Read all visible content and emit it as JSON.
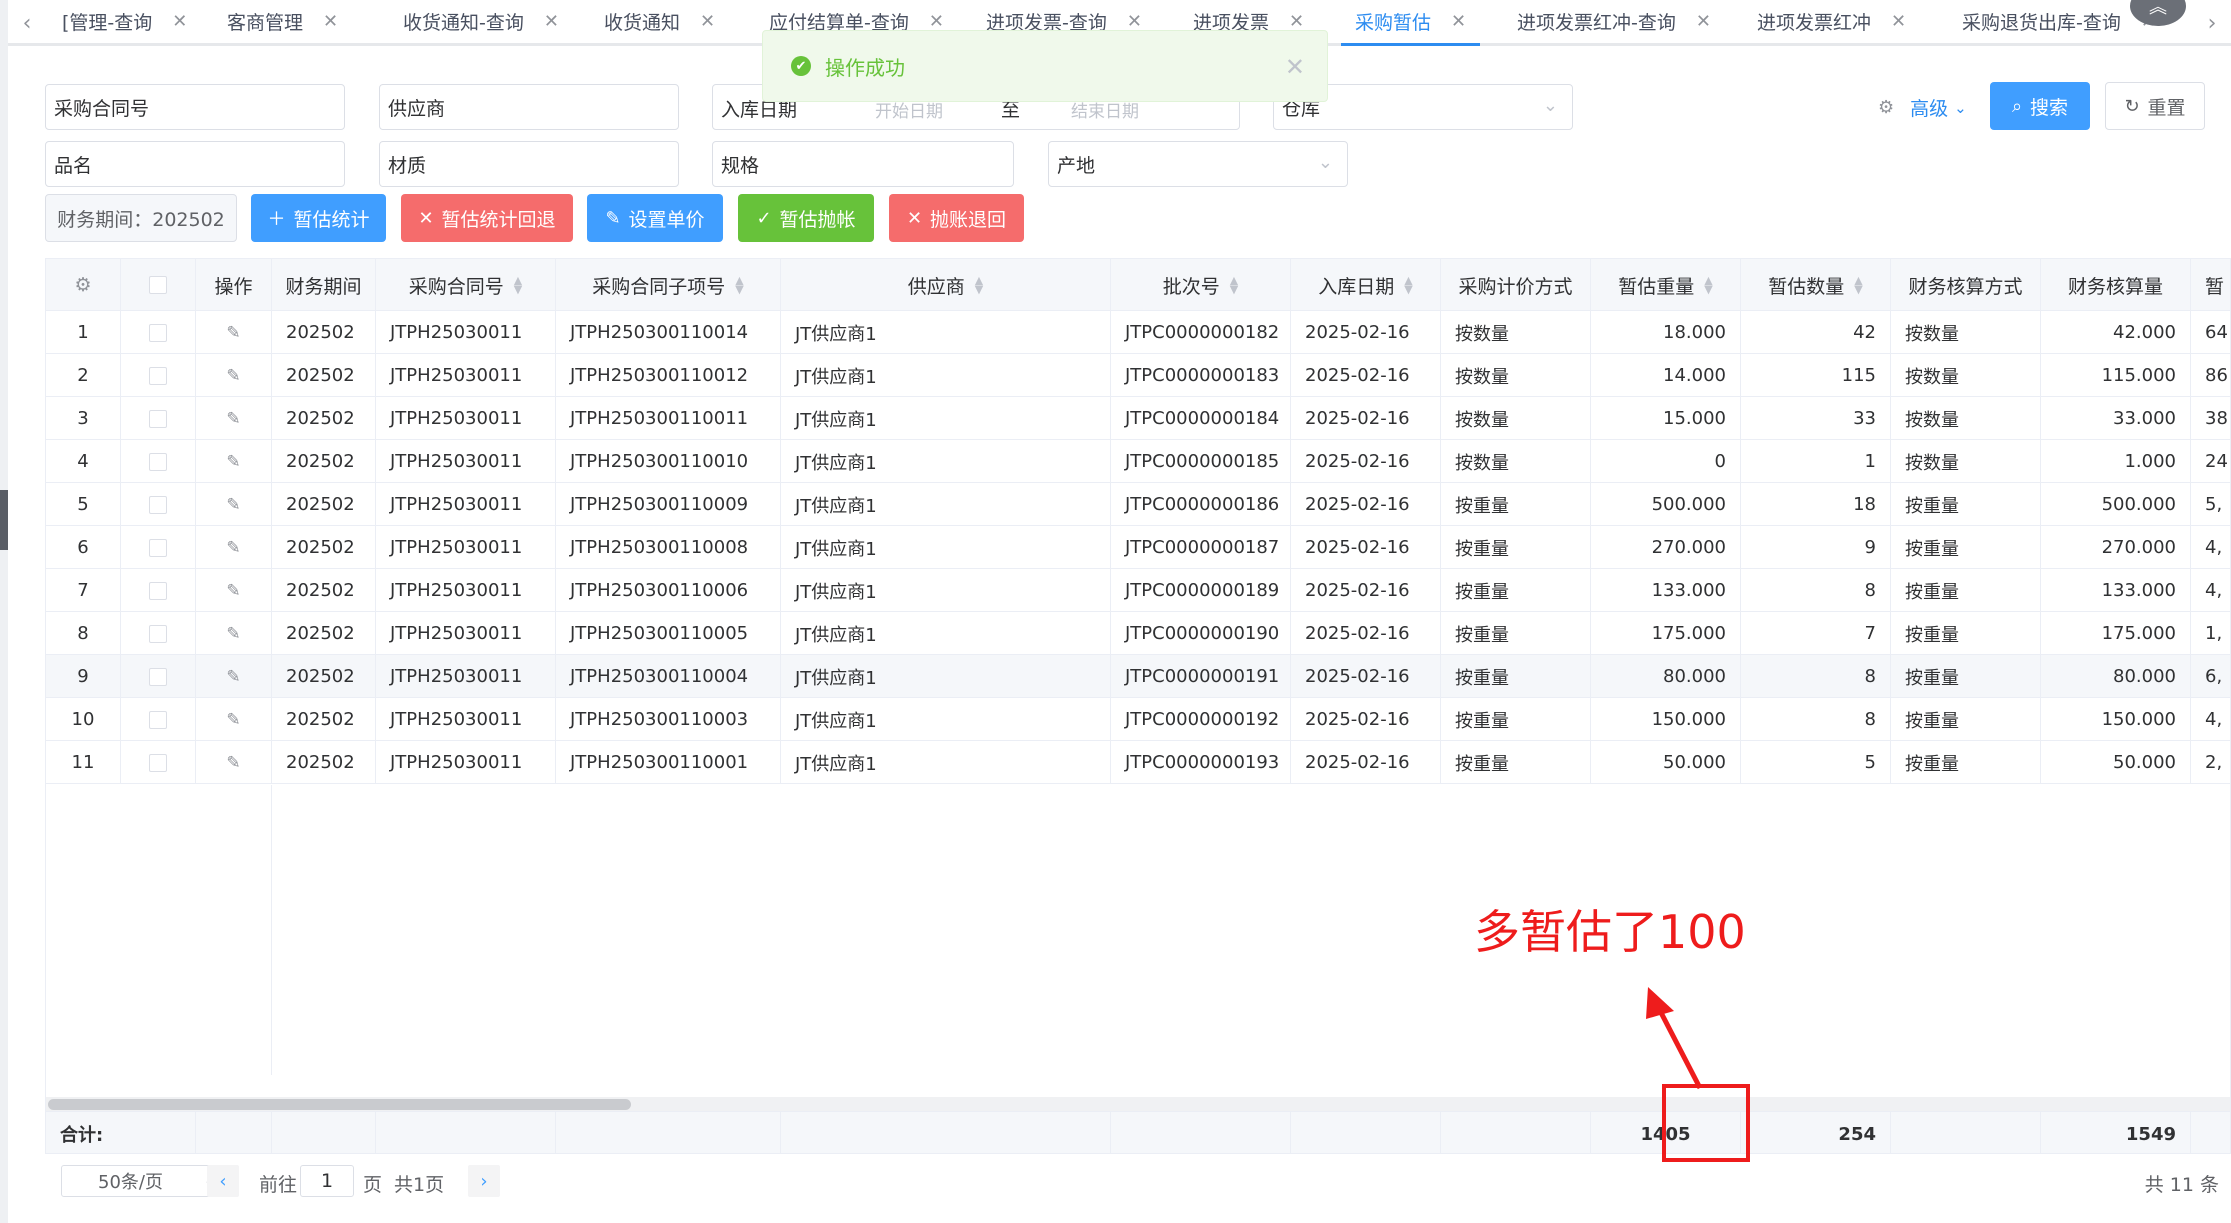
{
  "tabs": {
    "items": [
      {
        "label": "[管理-查询"
      },
      {
        "label": "客商管理"
      },
      {
        "label": "收货通知-查询"
      },
      {
        "label": "收货通知"
      },
      {
        "label": "应付结算单-查询"
      },
      {
        "label": "进项发票-查询"
      },
      {
        "label": "进项发票"
      },
      {
        "label": "采购暂估",
        "active": true
      },
      {
        "label": "进项发票红冲-查询"
      },
      {
        "label": "进项发票红冲"
      },
      {
        "label": "采购退货出库-查询"
      }
    ]
  },
  "toast": {
    "message": "操作成功"
  },
  "filters": {
    "contract_no": "采购合同号",
    "supplier": "供应商",
    "date_label": "入库日期",
    "date_start_placeholder": "开始日期",
    "date_sep": "至",
    "date_end_placeholder": "结束日期",
    "warehouse": "仓库",
    "product_name": "品名",
    "material": "材质",
    "spec": "规格",
    "origin": "产地",
    "period": "财务期间：202502"
  },
  "actions": {
    "advanced": "高级",
    "search": "搜索",
    "reset": "重置",
    "estimate_stat": "暂估统计",
    "estimate_rollback": "暂估统计回退",
    "set_price": "设置单价",
    "estimate_post": "暂估抛帐",
    "post_rollback": "抛账退回"
  },
  "table": {
    "headers": {
      "op": "操作",
      "period": "财务期间",
      "contract": "采购合同号",
      "sub_item": "采购合同子项号",
      "supplier": "供应商",
      "batch": "批次号",
      "in_date": "入库日期",
      "pricing": "采购计价方式",
      "est_weight": "暂估重量",
      "est_qty": "暂估数量",
      "acct_method": "财务核算方式",
      "acct_qty": "财务核算量",
      "next": "暂"
    },
    "rows": [
      {
        "no": "1",
        "period": "202502",
        "contract": "JTPH25030011",
        "sub_item": "JTPH250300110014",
        "supplier": "JT供应商1",
        "batch": "JTPC0000000182",
        "in_date": "2025-02-16",
        "pricing": "按数量",
        "est_weight": "18.000",
        "est_qty": "42",
        "acct_method": "按数量",
        "acct_qty": "42.000",
        "next": "64"
      },
      {
        "no": "2",
        "period": "202502",
        "contract": "JTPH25030011",
        "sub_item": "JTPH250300110012",
        "supplier": "JT供应商1",
        "batch": "JTPC0000000183",
        "in_date": "2025-02-16",
        "pricing": "按数量",
        "est_weight": "14.000",
        "est_qty": "115",
        "acct_method": "按数量",
        "acct_qty": "115.000",
        "next": "86"
      },
      {
        "no": "3",
        "period": "202502",
        "contract": "JTPH25030011",
        "sub_item": "JTPH250300110011",
        "supplier": "JT供应商1",
        "batch": "JTPC0000000184",
        "in_date": "2025-02-16",
        "pricing": "按数量",
        "est_weight": "15.000",
        "est_qty": "33",
        "acct_method": "按数量",
        "acct_qty": "33.000",
        "next": "38"
      },
      {
        "no": "4",
        "period": "202502",
        "contract": "JTPH25030011",
        "sub_item": "JTPH250300110010",
        "supplier": "JT供应商1",
        "batch": "JTPC0000000185",
        "in_date": "2025-02-16",
        "pricing": "按数量",
        "est_weight": "0",
        "est_qty": "1",
        "acct_method": "按数量",
        "acct_qty": "1.000",
        "next": "24"
      },
      {
        "no": "5",
        "period": "202502",
        "contract": "JTPH25030011",
        "sub_item": "JTPH250300110009",
        "supplier": "JT供应商1",
        "batch": "JTPC0000000186",
        "in_date": "2025-02-16",
        "pricing": "按重量",
        "est_weight": "500.000",
        "est_qty": "18",
        "acct_method": "按重量",
        "acct_qty": "500.000",
        "next": "5,"
      },
      {
        "no": "6",
        "period": "202502",
        "contract": "JTPH25030011",
        "sub_item": "JTPH250300110008",
        "supplier": "JT供应商1",
        "batch": "JTPC0000000187",
        "in_date": "2025-02-16",
        "pricing": "按重量",
        "est_weight": "270.000",
        "est_qty": "9",
        "acct_method": "按重量",
        "acct_qty": "270.000",
        "next": "4,"
      },
      {
        "no": "7",
        "period": "202502",
        "contract": "JTPH25030011",
        "sub_item": "JTPH250300110006",
        "supplier": "JT供应商1",
        "batch": "JTPC0000000189",
        "in_date": "2025-02-16",
        "pricing": "按重量",
        "est_weight": "133.000",
        "est_qty": "8",
        "acct_method": "按重量",
        "acct_qty": "133.000",
        "next": "4,"
      },
      {
        "no": "8",
        "period": "202502",
        "contract": "JTPH25030011",
        "sub_item": "JTPH250300110005",
        "supplier": "JT供应商1",
        "batch": "JTPC0000000190",
        "in_date": "2025-02-16",
        "pricing": "按重量",
        "est_weight": "175.000",
        "est_qty": "7",
        "acct_method": "按重量",
        "acct_qty": "175.000",
        "next": "1,"
      },
      {
        "no": "9",
        "period": "202502",
        "contract": "JTPH25030011",
        "sub_item": "JTPH250300110004",
        "supplier": "JT供应商1",
        "batch": "JTPC0000000191",
        "in_date": "2025-02-16",
        "pricing": "按重量",
        "est_weight": "80.000",
        "est_qty": "8",
        "acct_method": "按重量",
        "acct_qty": "80.000",
        "next": "6,"
      },
      {
        "no": "10",
        "period": "202502",
        "contract": "JTPH25030011",
        "sub_item": "JTPH250300110003",
        "supplier": "JT供应商1",
        "batch": "JTPC0000000192",
        "in_date": "2025-02-16",
        "pricing": "按重量",
        "est_weight": "150.000",
        "est_qty": "8",
        "acct_method": "按重量",
        "acct_qty": "150.000",
        "next": "4,"
      },
      {
        "no": "11",
        "period": "202502",
        "contract": "JTPH25030011",
        "sub_item": "JTPH250300110001",
        "supplier": "JT供应商1",
        "batch": "JTPC0000000193",
        "in_date": "2025-02-16",
        "pricing": "按重量",
        "est_weight": "50.000",
        "est_qty": "5",
        "acct_method": "按重量",
        "acct_qty": "50.000",
        "next": "2,"
      }
    ],
    "footer": {
      "label": "合计:",
      "est_weight": "1405",
      "est_qty": "254",
      "acct_qty": "1549"
    },
    "hover_row": 9
  },
  "pager": {
    "page_size": "50条/页",
    "goto": "前往",
    "page": "1",
    "page_unit": "页",
    "total_pages": "共1页",
    "total": "共 11 条"
  },
  "annotation": {
    "text": "多暂估了100"
  },
  "colors": {
    "primary": "#409eff",
    "danger": "#f56c6c",
    "success": "#67c23a",
    "annotation": "#ee1c1c"
  }
}
